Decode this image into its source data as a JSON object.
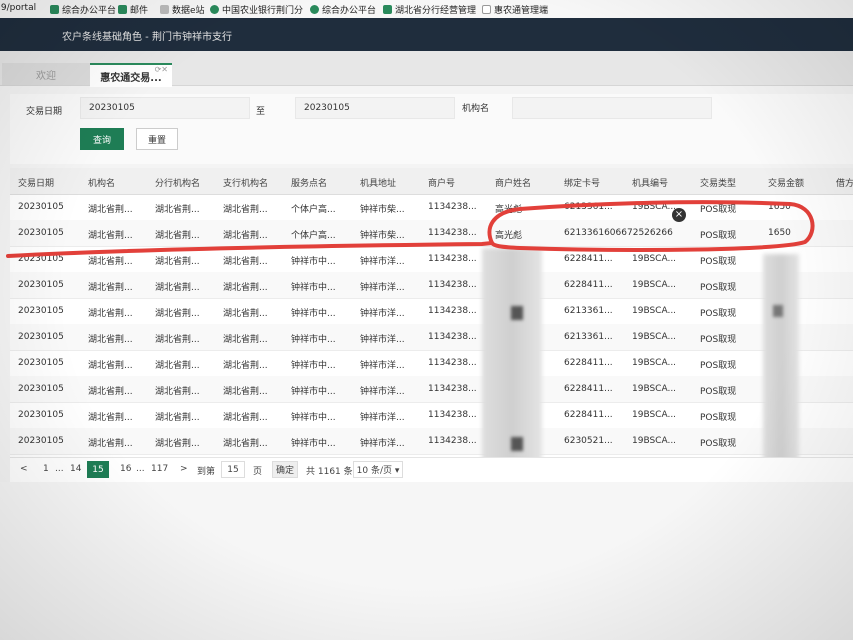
{
  "bookmarks": [
    {
      "label": ".9/portal"
    },
    {
      "label": "综合办公平台"
    },
    {
      "label": "邮件"
    },
    {
      "label": "数据e站"
    },
    {
      "label": "中国农业银行荆门分"
    },
    {
      "label": "综合办公平台"
    },
    {
      "label": "湖北省分行经营管理"
    },
    {
      "label": "惠农通管理端"
    }
  ],
  "header": {
    "title": "农户条线基础角色 - 荆门市钟祥市支行"
  },
  "tabs": [
    {
      "label": "欢迎"
    },
    {
      "label": "惠农通交易..."
    }
  ],
  "search": {
    "date_label": "交易日期",
    "date_from": "20230105",
    "to_label": "至",
    "date_to": "20230105",
    "org_label": "机构名",
    "query_button": "查询",
    "reset_button": "重置"
  },
  "table": {
    "columns": [
      "交易日期",
      "机构名",
      "分行机构名",
      "支行机构名",
      "服务点名",
      "机具地址",
      "商户号",
      "商户姓名",
      "绑定卡号",
      "机具编号",
      "交易类型",
      "交易金额",
      "借方"
    ],
    "rows": [
      [
        "20230105",
        "湖北省荆...",
        "湖北省荆...",
        "湖北省荆...",
        "个体户高...",
        "钟祥市柴...",
        "1134238...",
        "高光彪",
        "6213361...",
        "19BSCA...",
        "POS取现",
        "1650"
      ],
      [
        "20230105",
        "湖北省荆...",
        "湖北省荆...",
        "湖北省荆...",
        "个体户高...",
        "钟祥市柴...",
        "1134238...",
        "高光彪",
        "6213361606672526266",
        "",
        "POS取现",
        "1650"
      ],
      [
        "20230105",
        "湖北省荆...",
        "湖北省荆...",
        "湖北省荆...",
        "钟祥市中...",
        "钟祥市洋...",
        "1134238...",
        "",
        "6228411...",
        "19BSCA...",
        "POS取现",
        ""
      ],
      [
        "20230105",
        "湖北省荆...",
        "湖北省荆...",
        "湖北省荆...",
        "钟祥市中...",
        "钟祥市洋...",
        "1134238...",
        "",
        "6228411...",
        "19BSCA...",
        "POS取现",
        ""
      ],
      [
        "20230105",
        "湖北省荆...",
        "湖北省荆...",
        "湖北省荆...",
        "钟祥市中...",
        "钟祥市洋...",
        "1134238...",
        "",
        "6213361...",
        "19BSCA...",
        "POS取现",
        ""
      ],
      [
        "20230105",
        "湖北省荆...",
        "湖北省荆...",
        "湖北省荆...",
        "钟祥市中...",
        "钟祥市洋...",
        "1134238...",
        "",
        "6213361...",
        "19BSCA...",
        "POS取现",
        ""
      ],
      [
        "20230105",
        "湖北省荆...",
        "湖北省荆...",
        "湖北省荆...",
        "钟祥市中...",
        "钟祥市洋...",
        "1134238...",
        "",
        "6228411...",
        "19BSCA...",
        "POS取现",
        ""
      ],
      [
        "20230105",
        "湖北省荆...",
        "湖北省荆...",
        "湖北省荆...",
        "钟祥市中...",
        "钟祥市洋...",
        "1134238...",
        "",
        "6228411...",
        "19BSCA...",
        "POS取现",
        ""
      ],
      [
        "20230105",
        "湖北省荆...",
        "湖北省荆...",
        "湖北省荆...",
        "钟祥市中...",
        "钟祥市洋...",
        "1134238...",
        "",
        "6228411...",
        "19BSCA...",
        "POS取现",
        ""
      ],
      [
        "20230105",
        "湖北省荆...",
        "湖北省荆...",
        "湖北省荆...",
        "钟祥市中...",
        "钟祥市洋...",
        "1134238...",
        "",
        "6230521...",
        "19BSCA...",
        "POS取现",
        ""
      ]
    ]
  },
  "pager": {
    "prev": "<",
    "pages": [
      "1",
      "...",
      "14",
      "15",
      "16",
      "...",
      "117"
    ],
    "next": ">",
    "goto_label": "到第",
    "goto_value": "15",
    "page_unit": "页",
    "confirm": "确定",
    "total": "共 1161 条",
    "page_size": "10 条/页 ▾"
  },
  "colors": {
    "header": "#1f2d3d",
    "accent": "#1e7d55",
    "annotation_red": "#e2403a"
  }
}
